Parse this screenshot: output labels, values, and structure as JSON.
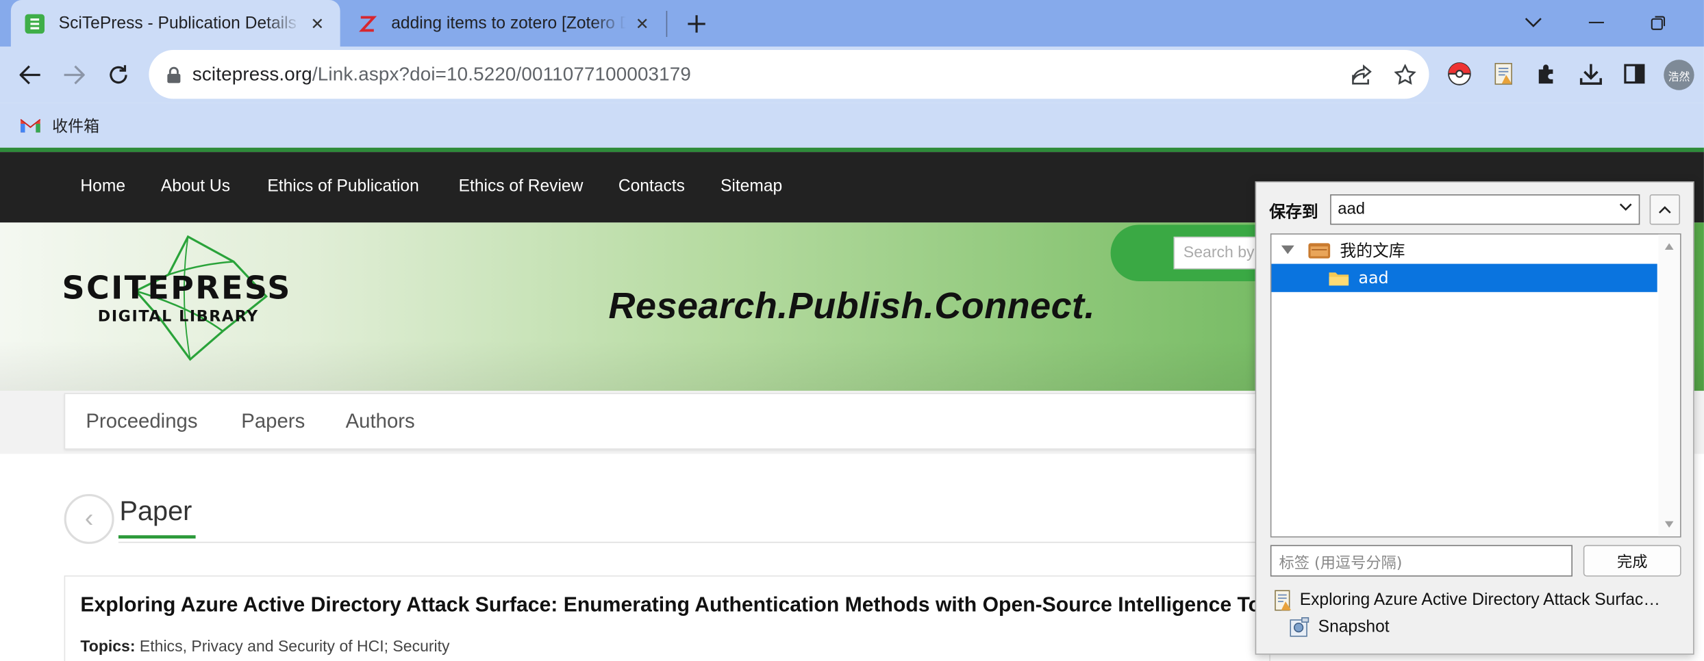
{
  "browser": {
    "tabs": [
      {
        "title": "SciTePress - Publication Details",
        "icon": "scitepress-favicon"
      },
      {
        "title": "adding items to zotero [Zotero Documentation]",
        "icon": "zotero-favicon"
      }
    ],
    "address": {
      "host": "scitepress.org",
      "path": "/Link.aspx?doi=10.5220/0011077100003179"
    },
    "profile_initials": "浩然",
    "bookmarks": [
      {
        "label": "收件箱",
        "icon": "gmail-icon"
      }
    ]
  },
  "site": {
    "nav": [
      "Home",
      "About Us",
      "Ethics of Publication",
      "Ethics of Review",
      "Contacts",
      "Sitemap"
    ],
    "logo": {
      "line1": "SCITEPRESS",
      "line2": "DIGITAL LIBRARY"
    },
    "tagline": "Research.Publish.Connect.",
    "search_placeholder": "Search by",
    "subnav": [
      "Proceedings",
      "Papers",
      "Authors"
    ],
    "page_heading": "Paper",
    "paper": {
      "title": "Exploring Azure Active Directory Attack Surface: Enumerating Authentication Methods with Open-Source Intelligence Tools",
      "topics_label": "Topics:",
      "topics": "Ethics, Privacy and Security of HCI; Security"
    }
  },
  "zotero": {
    "save_to_label": "保存到",
    "collection": "aad",
    "tree": [
      {
        "label": "我的文库",
        "level": 0,
        "selected": false,
        "icon": "library-icon"
      },
      {
        "label": "aad",
        "level": 1,
        "selected": true,
        "icon": "folder-icon"
      }
    ],
    "tags_placeholder": "标签 (用逗号分隔)",
    "done_label": "完成",
    "items": [
      {
        "label": "Exploring Azure Active Directory Attack Surfac…",
        "icon": "journal-article-icon"
      },
      {
        "label": "Snapshot",
        "icon": "snapshot-icon"
      }
    ]
  },
  "colors": {
    "site_accent": "#2c9a3a",
    "nav_bg": "#222222",
    "zotero_selection": "#0a74df",
    "chrome_tabstrip": "#86aaeb"
  }
}
